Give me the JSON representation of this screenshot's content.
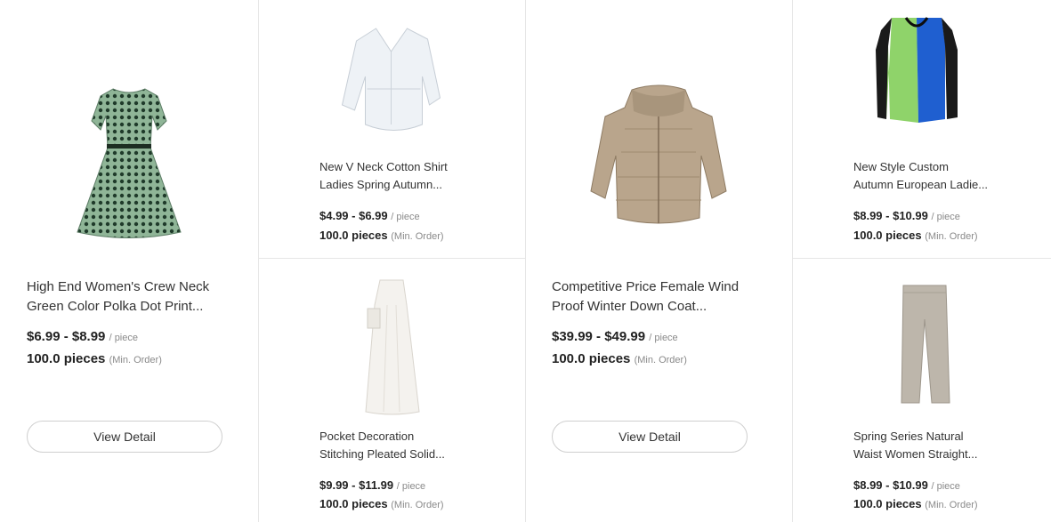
{
  "products": [
    {
      "title_line1": "High End Women's Crew Neck",
      "title_line2": "Green Color Polka Dot Print...",
      "price": "$6.99 - $8.99",
      "unit": "/ piece",
      "moq": "100.0 pieces",
      "moq_label": "(Min. Order)",
      "button": "View Detail",
      "image": "green-polka-dot-dress"
    },
    {
      "title_line1": "New V Neck Cotton Shirt",
      "title_line2": "Ladies Spring Autumn...",
      "price": "$4.99 - $6.99",
      "unit": "/ piece",
      "moq": "100.0 pieces",
      "moq_label": "(Min. Order)",
      "image": "white-cotton-shirt"
    },
    {
      "title_line1": "Pocket Decoration",
      "title_line2": "Stitching Pleated Solid...",
      "price": "$9.99 - $11.99",
      "unit": "/ piece",
      "moq": "100.0 pieces",
      "moq_label": "(Min. Order)",
      "image": "white-pleated-skirt"
    },
    {
      "title_line1": "Competitive Price Female Wind",
      "title_line2": "Proof Winter Down Coat...",
      "price": "$39.99 - $49.99",
      "unit": "/ piece",
      "moq": "100.0 pieces",
      "moq_label": "(Min. Order)",
      "button": "View Detail",
      "image": "beige-down-coat"
    },
    {
      "title_line1": "New Style Custom",
      "title_line2": "Autumn European Ladie...",
      "price": "$8.99 - $10.99",
      "unit": "/ piece",
      "moq": "100.0 pieces",
      "moq_label": "(Min. Order)",
      "image": "green-blue-cardigan"
    },
    {
      "title_line1": "Spring Series Natural",
      "title_line2": "Waist Women Straight...",
      "price": "$8.99 - $10.99",
      "unit": "/ piece",
      "moq": "100.0 pieces",
      "moq_label": "(Min. Order)",
      "image": "grey-straight-trousers"
    }
  ]
}
